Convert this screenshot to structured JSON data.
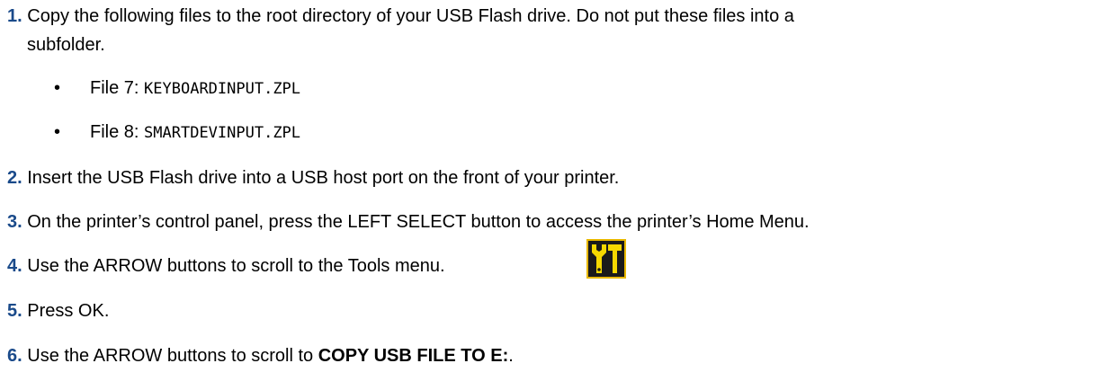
{
  "steps": [
    {
      "number": "1.",
      "line1": "Copy the following files to the root directory of your USB Flash drive. Do not put these files into a",
      "line2": "subfolder."
    },
    {
      "number": "2.",
      "text": "Insert the USB Flash drive into a USB host port on the front of your printer."
    },
    {
      "number": "3.",
      "text": "On the printer’s control panel, press the LEFT SELECT button to access the printer’s Home Menu."
    },
    {
      "number": "4.",
      "text": "Use the ARROW buttons to scroll to the Tools menu."
    },
    {
      "number": "5.",
      "text": "Press OK."
    },
    {
      "number": "6.",
      "text_before": "Use the ARROW buttons to scroll to ",
      "bold": "COPY USB FILE TO E:",
      "text_after": "."
    }
  ],
  "files": [
    {
      "label": "File 7: ",
      "name": "KEYBOARDINPUT.ZPL"
    },
    {
      "label": "File 8: ",
      "name": "SMARTDEVINPUT.ZPL"
    }
  ],
  "bullet_char": "•",
  "icon": {
    "name": "tools-icon",
    "background": "#1a1a1a",
    "border": "#e8b800",
    "glyph": "#f5d800"
  }
}
